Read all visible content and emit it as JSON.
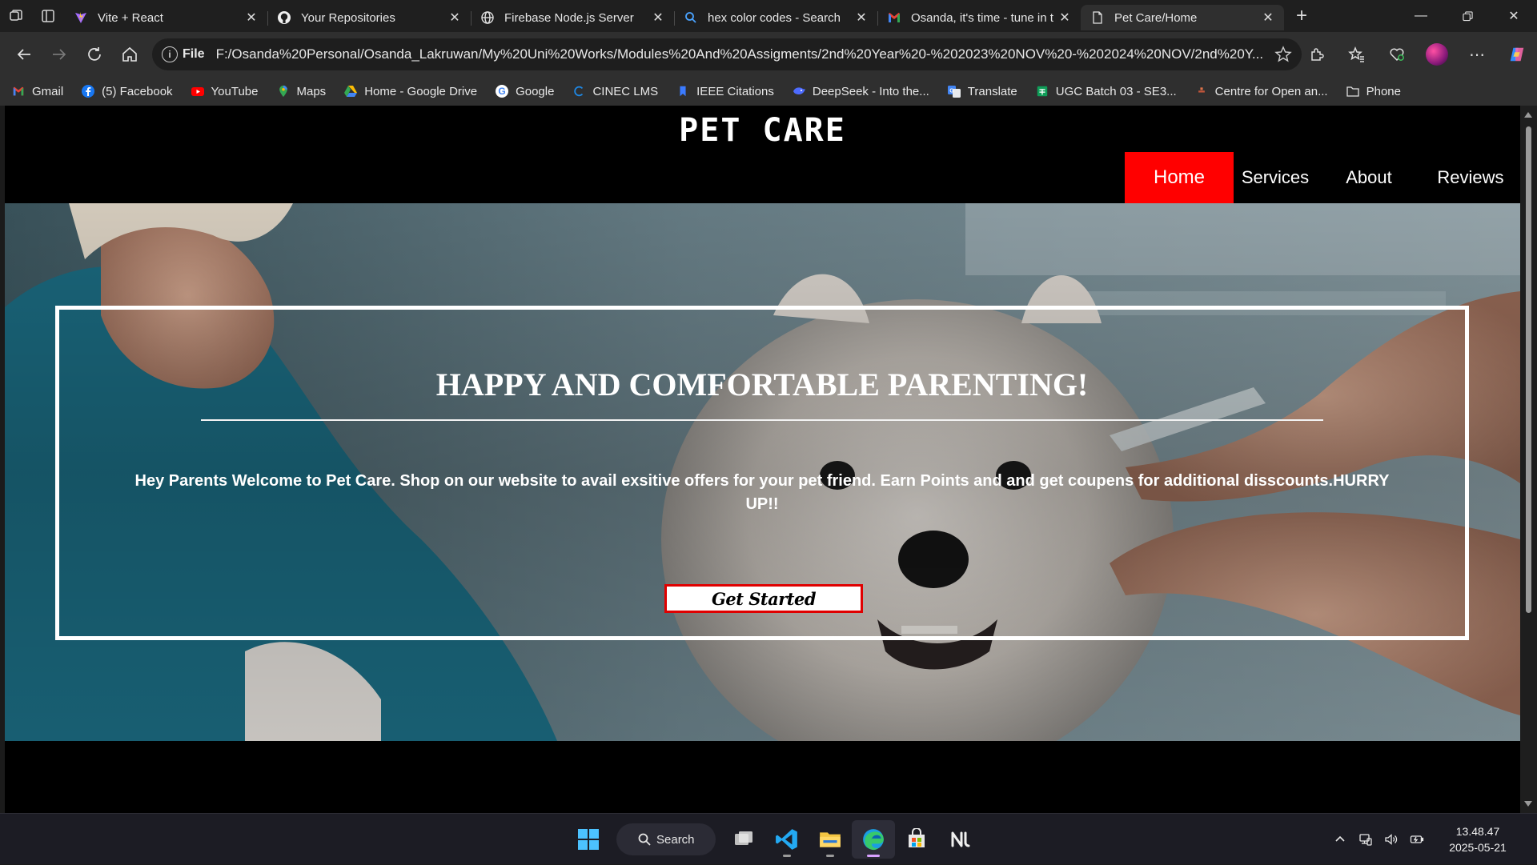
{
  "browser": {
    "tabs": [
      {
        "title": "Vite + React",
        "icon": "vite-icon",
        "active": false
      },
      {
        "title": "Your Repositories",
        "icon": "github-icon",
        "active": false
      },
      {
        "title": "Firebase Node.js Server",
        "icon": "globe-icon",
        "active": false
      },
      {
        "title": "hex color codes - Search",
        "icon": "bing-search-icon",
        "active": false
      },
      {
        "title": "Osanda, it's time - tune in t",
        "icon": "gmail-icon",
        "active": false
      },
      {
        "title": "Pet Care/Home",
        "icon": "page-icon",
        "active": true
      }
    ],
    "address_scheme": "File",
    "address_url": "F:/Osanda%20Personal/Osanda_Lakruwan/My%20Uni%20Works/Modules%20And%20Assigments/2nd%20Year%20-%202023%20NOV%20-%202024%20NOV/2nd%20Y...",
    "bookmarks": [
      {
        "label": "Gmail",
        "icon": "gmail-icon"
      },
      {
        "label": "(5) Facebook",
        "icon": "facebook-icon"
      },
      {
        "label": "YouTube",
        "icon": "youtube-icon"
      },
      {
        "label": "Maps",
        "icon": "maps-icon"
      },
      {
        "label": "Home - Google Drive",
        "icon": "google-drive-icon"
      },
      {
        "label": "Google",
        "icon": "google-icon"
      },
      {
        "label": "CINEC LMS",
        "icon": "cinec-icon"
      },
      {
        "label": "IEEE Citations",
        "icon": "bookmark-icon"
      },
      {
        "label": "DeepSeek - Into the...",
        "icon": "deepseek-icon"
      },
      {
        "label": "Translate",
        "icon": "translate-icon"
      },
      {
        "label": "UGC Batch 03 - SE3...",
        "icon": "sheets-icon"
      },
      {
        "label": "Centre for Open an...",
        "icon": "centre-icon"
      },
      {
        "label": "Phone",
        "icon": "folder-icon"
      }
    ]
  },
  "site": {
    "title": "PET CARE",
    "nav": [
      "Home",
      "Services",
      "About",
      "Reviews"
    ],
    "hero": {
      "heading": "HAPPY AND COMFORTABLE PARENTING!",
      "text": "Hey Parents Welcome to Pet Care. Shop on our website to avail exsitive offers for your pet friend. Earn Points and and get coupens for additional disscounts.HURRY UP!!",
      "cta": "Get Started"
    }
  },
  "taskbar": {
    "search_label": "Search",
    "time": "13.48.47",
    "date": "2025-05-21"
  },
  "colors": {
    "accent_red": "#ff0000",
    "page_bg": "#000000",
    "chrome_bg": "#2f2f2f"
  }
}
